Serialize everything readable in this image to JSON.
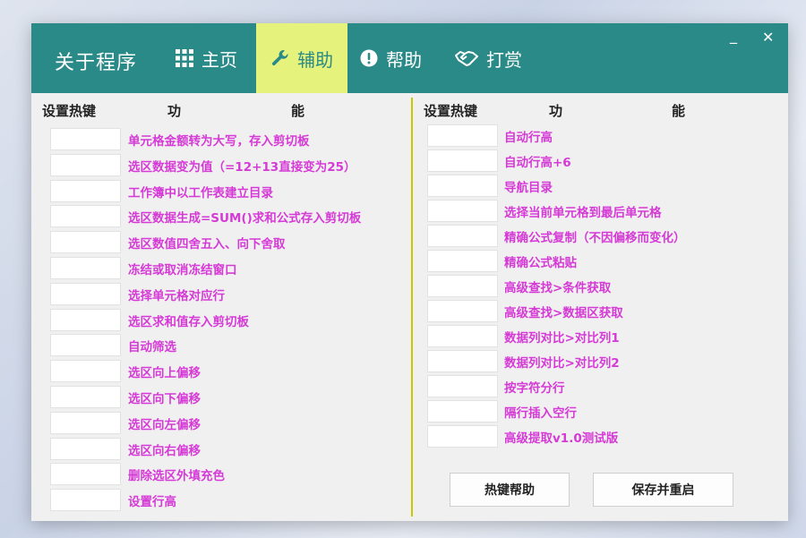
{
  "app_title": "关于程序",
  "nav": {
    "home": "主页",
    "tools": "辅助",
    "help": "帮助",
    "donate": "打赏"
  },
  "window_buttons": {
    "minimize": "_",
    "close": "✕"
  },
  "headers": {
    "hotkey": "设置热键",
    "func_1": "功",
    "func_2": "能"
  },
  "left_items": [
    "单元格金额转为大写，存入剪切板",
    "选区数据变为值（=12+13直接变为25）",
    "工作簿中以工作表建立目录",
    "选区数据生成=SUM()求和公式存入剪切板",
    "选区数值四舍五入、向下舍取",
    "冻结或取消冻结窗口",
    "选择单元格对应行",
    "选区求和值存入剪切板",
    "自动筛选",
    "选区向上偏移",
    "选区向下偏移",
    "选区向左偏移",
    "选区向右偏移",
    "删除选区外填充色",
    "设置行高"
  ],
  "right_items": [
    "自动行高",
    "自动行高+6",
    "导航目录",
    "选择当前单元格到最后单元格",
    "精确公式复制（不因偏移而变化）",
    "精确公式粘贴",
    "高级查找>条件获取",
    "高级查找>数据区获取",
    "数据列对比>对比列1",
    "数据列对比>对比列2",
    "按字符分行",
    "隔行插入空行",
    "高级提取v1.0测试版"
  ],
  "buttons": {
    "hotkey_help": "热键帮助",
    "save_restart": "保存并重启"
  },
  "colors": {
    "titlebar": "#2a8a87",
    "active_tab": "#e5f27c",
    "label": "#d63ad6",
    "divider": "#c8c800"
  }
}
